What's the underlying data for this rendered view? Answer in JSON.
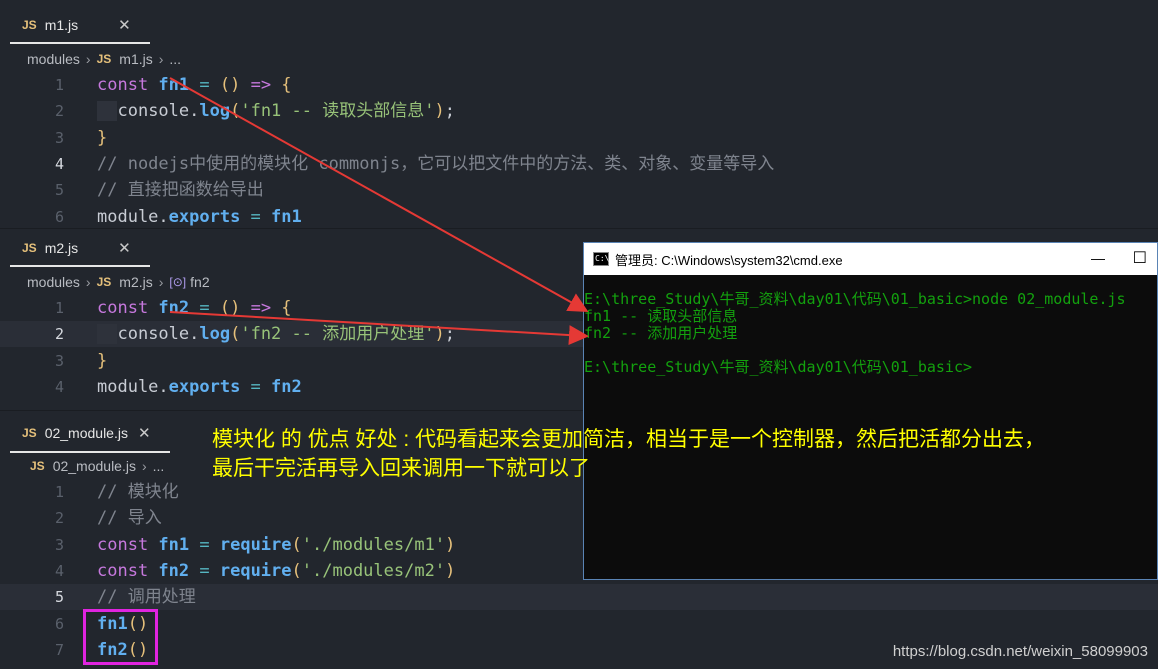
{
  "pane1": {
    "tab_label": "m1.js",
    "tab_js": "JS",
    "close": "✕",
    "breadcrumb": [
      "modules",
      "m1.js",
      "..."
    ],
    "lines": [
      {
        "n": "1",
        "tokens": [
          [
            "kw",
            "const "
          ],
          [
            "fn",
            "fn1"
          ],
          [
            "op",
            " = "
          ],
          [
            "par",
            "() "
          ],
          [
            "kw",
            "=> "
          ],
          [
            "par",
            "{"
          ]
        ]
      },
      {
        "n": "2",
        "tokens": [
          [
            "txt",
            "  console."
          ],
          [
            "fn2",
            "log"
          ],
          [
            "par",
            "("
          ],
          [
            "str",
            "'fn1 -- 读取头部信息'"
          ],
          [
            "par",
            ")"
          ],
          [
            "txt",
            ";"
          ]
        ]
      },
      {
        "n": "3",
        "tokens": [
          [
            "par",
            "}"
          ]
        ]
      },
      {
        "n": "4",
        "tokens": [
          [
            "cm",
            "// nodejs中使用的模块化 commonjs，它可以把文件中的方法、类、对象、变量等导入"
          ]
        ]
      },
      {
        "n": "5",
        "tokens": [
          [
            "cm",
            "// 直接把函数给导出"
          ]
        ]
      },
      {
        "n": "6",
        "tokens": [
          [
            "txt",
            "module."
          ],
          [
            "fn",
            "exports"
          ],
          [
            "op",
            " = "
          ],
          [
            "fn",
            "fn1"
          ]
        ]
      }
    ]
  },
  "pane2": {
    "tab_label": "m2.js",
    "tab_js": "JS",
    "close": "✕",
    "breadcrumb": [
      "modules",
      "m2.js",
      "fn2"
    ],
    "lines": [
      {
        "n": "1",
        "tokens": [
          [
            "kw",
            "const "
          ],
          [
            "fn",
            "fn2"
          ],
          [
            "op",
            " = "
          ],
          [
            "par",
            "() "
          ],
          [
            "kw",
            "=> "
          ],
          [
            "par",
            "{"
          ]
        ]
      },
      {
        "n": "2",
        "tokens": [
          [
            "txt",
            "  console."
          ],
          [
            "fn2",
            "log"
          ],
          [
            "par",
            "("
          ],
          [
            "str",
            "'fn2 -- 添加用户处理'"
          ],
          [
            "par",
            ")"
          ],
          [
            "txt",
            ";"
          ]
        ]
      },
      {
        "n": "3",
        "tokens": [
          [
            "par",
            "}"
          ]
        ]
      },
      {
        "n": "4",
        "tokens": [
          [
            "txt",
            "module."
          ],
          [
            "fn",
            "exports"
          ],
          [
            "op",
            " = "
          ],
          [
            "fn",
            "fn2"
          ]
        ]
      }
    ]
  },
  "pane3": {
    "tab_label": "02_module.js",
    "tab_js": "JS",
    "close": "✕",
    "breadcrumb": [
      "02_module.js",
      "..."
    ],
    "lines": [
      {
        "n": "1",
        "tokens": [
          [
            "cm",
            "// 模块化"
          ]
        ]
      },
      {
        "n": "2",
        "tokens": [
          [
            "cm",
            "// 导入"
          ]
        ]
      },
      {
        "n": "3",
        "tokens": [
          [
            "kw",
            "const "
          ],
          [
            "fn",
            "fn1"
          ],
          [
            "op",
            " = "
          ],
          [
            "fn2",
            "require"
          ],
          [
            "par",
            "("
          ],
          [
            "str",
            "'./modules/m1'"
          ],
          [
            "par",
            ")"
          ]
        ]
      },
      {
        "n": "4",
        "tokens": [
          [
            "kw",
            "const "
          ],
          [
            "fn",
            "fn2"
          ],
          [
            "op",
            " = "
          ],
          [
            "fn2",
            "require"
          ],
          [
            "par",
            "("
          ],
          [
            "str",
            "'./modules/m2'"
          ],
          [
            "par",
            ")"
          ]
        ]
      },
      {
        "n": "5",
        "tokens": [
          [
            "cm",
            "// 调用处理"
          ]
        ]
      },
      {
        "n": "6",
        "tokens": [
          [
            "fn",
            "fn1"
          ],
          [
            "par",
            "()"
          ]
        ]
      },
      {
        "n": "7",
        "tokens": [
          [
            "fn",
            "fn2"
          ],
          [
            "par",
            "()"
          ]
        ]
      }
    ]
  },
  "cmd": {
    "title": "管理员: C:\\Windows\\system32\\cmd.exe",
    "minimize": "—",
    "maximize": "☐",
    "lines": [
      "E:\\three_Study\\牛哥_资料\\day01\\代码\\01_basic>node 02_module.js",
      "fn1 -- 读取头部信息",
      "fn2 -- 添加用户处理",
      "",
      "E:\\three_Study\\牛哥_资料\\day01\\代码\\01_basic>"
    ]
  },
  "annotation": {
    "line1": "模块化 的 优点 好处 : 代码看起来会更加简洁，相当于是一个控制器，然后把活都分出去，",
    "line2": "最后干完活再导入回来调用一下就可以了"
  },
  "watermark": "https://blog.csdn.net/weixin_58099903",
  "colors": {
    "background": "#22262d",
    "keyword": "#c678dd",
    "function": "#61afef",
    "string": "#98c379",
    "comment": "#7f848e",
    "paren": "#e5c07b",
    "arrow": "#e53935",
    "highlight_box": "#e024e0",
    "annotation": "#ffff00",
    "cmd_text": "#13a10e"
  }
}
